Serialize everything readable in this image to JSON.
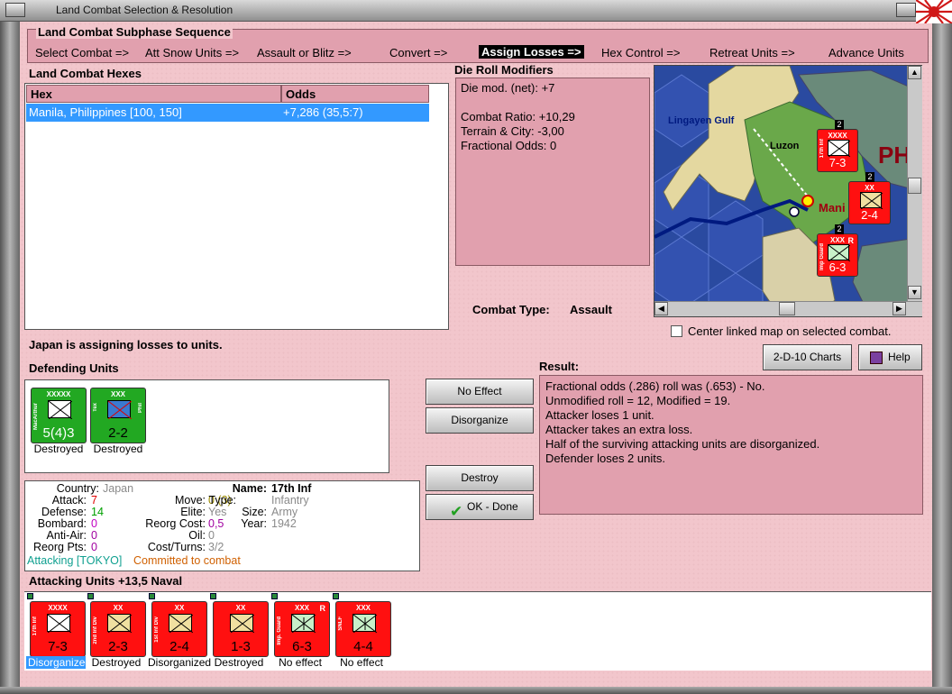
{
  "window": {
    "title": "Land Combat Selection & Resolution"
  },
  "subphase": {
    "title": "Land Combat Subphase Sequence",
    "steps": [
      "Select Combat =>",
      "Att Snow Units =>",
      "Assault or Blitz =>",
      "Convert =>",
      "Assign Losses =>",
      "Hex Control =>",
      "Retreat Units =>",
      "Advance Units"
    ],
    "active_index": 4
  },
  "hexes": {
    "title": "Land Combat Hexes",
    "col_hex": "Hex",
    "col_odds": "Odds",
    "rows": [
      {
        "hex": "Manila, Philippines [100, 150]",
        "odds": "+7,286 (35,5:7)"
      }
    ]
  },
  "die": {
    "title": "Die Roll Modifiers",
    "net": "Die mod. (net): +7",
    "ratio": "Combat Ratio: +10,29",
    "terrain": "Terrain & City: -3,00",
    "fractional": "Fractional Odds: 0"
  },
  "combat_type": {
    "label": "Combat Type:",
    "value": "Assault"
  },
  "map": {
    "labels": {
      "gulf": "Lingayen Gulf",
      "island": "Luzon",
      "ph": "PH",
      "mani": "Mani"
    },
    "counters": [
      {
        "size": "XXXX",
        "name": "17th Inf",
        "str": "7-3",
        "badge": "2"
      },
      {
        "size": "XX",
        "str": "2-4",
        "badge": "2"
      },
      {
        "size": "XXX",
        "name": "Imp Guard",
        "str": "6-3",
        "badge": "2",
        "r": "R"
      }
    ]
  },
  "center_map": {
    "label": "Center linked map on selected combat."
  },
  "status": {
    "message": "Japan is assigning losses to units."
  },
  "defending": {
    "title": "Defending Units",
    "units": [
      {
        "size": "XXXXX",
        "name": "MacArthur",
        "str": "5(4)3",
        "label": "Destroyed"
      },
      {
        "size": "XXX",
        "name_l": "Tex",
        "name_r": "Phil",
        "str": "2-2",
        "label": "Destroyed"
      }
    ]
  },
  "buttons": {
    "no_effect": "No Effect",
    "disorganize": "Disorganize",
    "destroy": "Destroy",
    "ok_done": "OK - Done",
    "charts": "2-D-10 Charts",
    "help": "Help"
  },
  "result": {
    "title": "Result:",
    "lines": [
      "Fractional odds (.286) roll was (.653)  - No.",
      "Unmodified roll = 12, Modified = 19.",
      "Attacker loses 1 unit.",
      "Attacker takes an extra loss.",
      "Half of the surviving attacking units are disorganized.",
      "Defender loses 2 units."
    ]
  },
  "info": {
    "country_l": "Country:",
    "country_v": "Japan",
    "attack_l": "Attack:",
    "attack_v": "7",
    "defense_l": "Defense:",
    "defense_v": "14",
    "bombard_l": "Bombard:",
    "bombard_v": "0",
    "antiair_l": "Anti-Air:",
    "antiair_v": "0",
    "reorg_l": "Reorg Pts:",
    "reorg_v": "0",
    "name_l": "Name:",
    "name_v": "17th Inf",
    "move_l": "Move:",
    "move_v": "0 (3)",
    "type_l": "Type:",
    "type_v": "Infantry",
    "elite_l": "Elite:",
    "elite_v": "Yes",
    "size_l": "Size:",
    "size_v": "Army",
    "reorgcost_l": "Reorg Cost:",
    "reorgcost_v": "0,5",
    "year_l": "Year:",
    "year_v": "1942",
    "oil_l": "Oil:",
    "oil_v": "0",
    "cost_l": "Cost/Turns:",
    "cost_v": "3/2",
    "attacking": "Attacking [TOKYO]",
    "committed": "Committed to combat"
  },
  "attacking": {
    "title": "Attacking Units +13,5 Naval",
    "units": [
      {
        "size": "XXXX",
        "name": "17th Inf",
        "str": "7-3",
        "label": "Disorganized"
      },
      {
        "size": "XX",
        "name": "2nd Inf Div",
        "str": "2-3",
        "label": "Destroyed"
      },
      {
        "size": "XX",
        "name": "1st Inf Div",
        "str": "2-4",
        "label": "Disorganized"
      },
      {
        "size": "XX",
        "str": "1-3",
        "label": "Destroyed"
      },
      {
        "size": "XXX",
        "name": "Imp. Guard",
        "str": "6-3",
        "r": "R",
        "label": "No effect"
      },
      {
        "size": "XXX",
        "name": "SNLF",
        "str": "4-4",
        "label": "No effect"
      }
    ]
  }
}
